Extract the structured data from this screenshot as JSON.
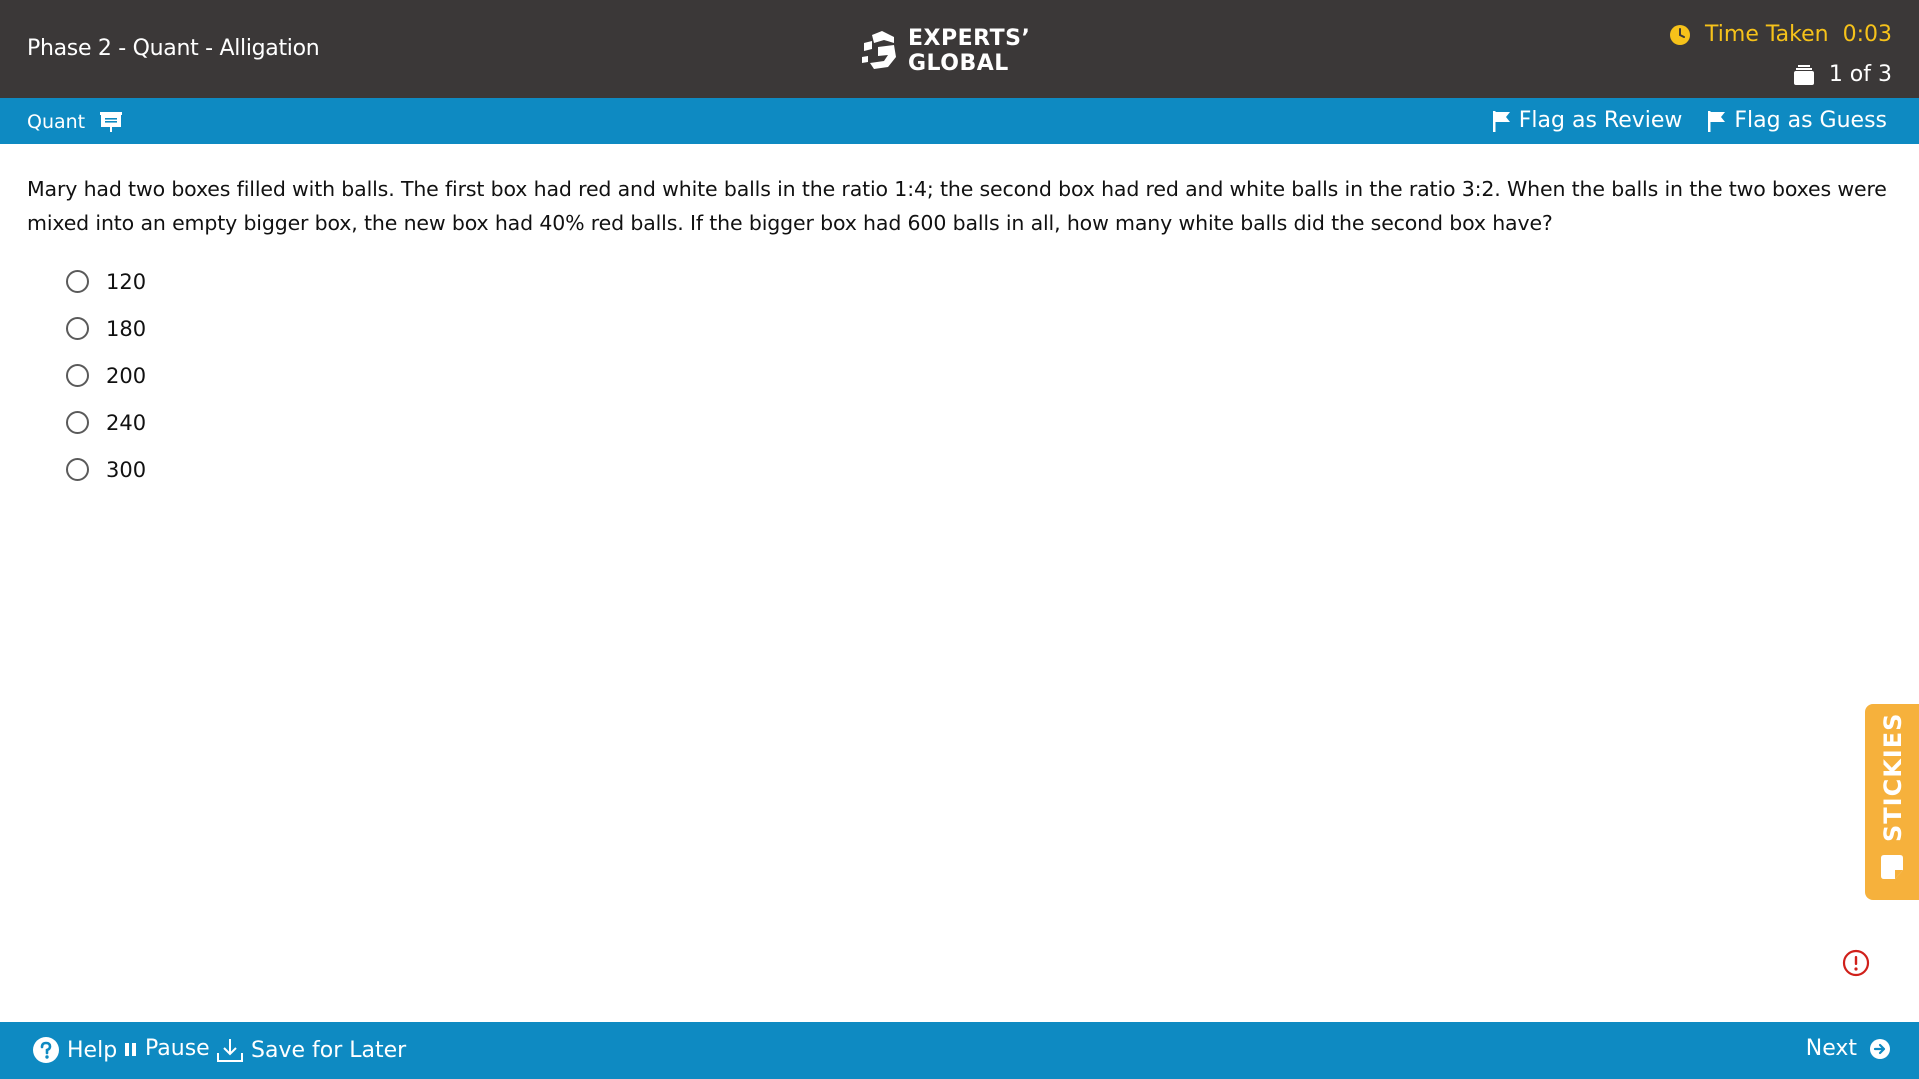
{
  "header": {
    "title": "Phase 2 - Quant - Alligation",
    "logo_line1": "EXPERTS’",
    "logo_line2": "GLOBAL",
    "time_label": "Time Taken",
    "time_value": "0:03",
    "question_counter": "1 of 3"
  },
  "section_bar": {
    "section_name": "Quant",
    "flag_review": "Flag as Review",
    "flag_guess": "Flag as Guess"
  },
  "question": {
    "text": "Mary had two boxes filled with balls. The first box had red and white balls in the ratio 1:4; the second box had red and white balls in the ratio 3:2. When the balls in the two boxes were mixed into an empty bigger box, the new box had 40% red balls. If the bigger box had 600 balls in all, how many white balls did the second box have?",
    "options": [
      "120",
      "180",
      "200",
      "240",
      "300"
    ]
  },
  "stickies": {
    "label": "STICKIES"
  },
  "footer": {
    "help": "Help",
    "pause": "Pause",
    "save": "Save for Later",
    "next": "Next"
  },
  "colors": {
    "header_bg": "#3b3838",
    "bar_blue": "#0e8ac2",
    "timer_yellow": "#f6c21a",
    "stickies_orange": "#f6b13c",
    "report_red": "#d0201a"
  }
}
